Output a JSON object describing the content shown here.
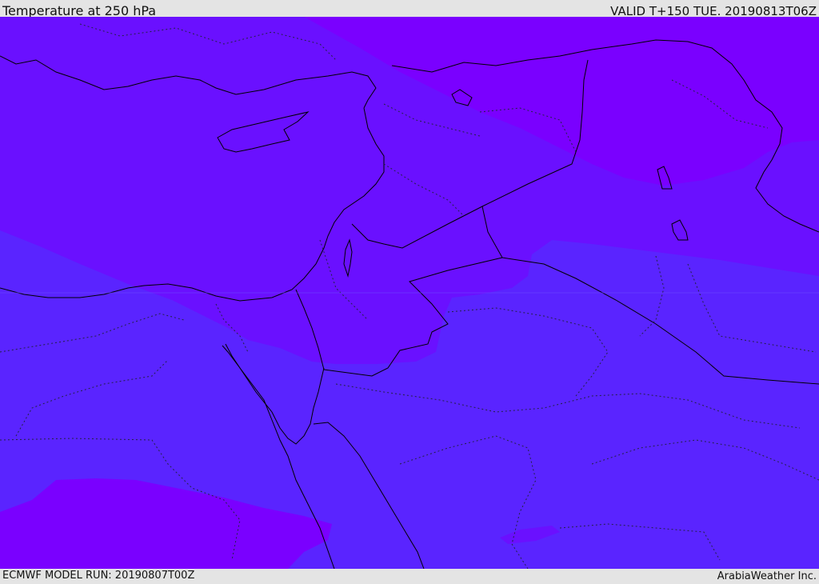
{
  "header": {
    "title": "Temperature at 250 hPa",
    "valid": "VALID T+150 TUE. 20190813T06Z"
  },
  "footer": {
    "model_run": "ECMWF MODEL RUN: 20190807T00Z",
    "brand": "ArabiaWeather Inc."
  },
  "map": {
    "region": "Eastern Mediterranean / Levant / Northern Arabia",
    "field": "temperature at 250 hPa (shaded)",
    "colors": {
      "coldest": "#7a00ff",
      "cold": "#6a10ff",
      "mid": "#5a24ff",
      "border": "#000000",
      "subborder": "#222244"
    }
  }
}
